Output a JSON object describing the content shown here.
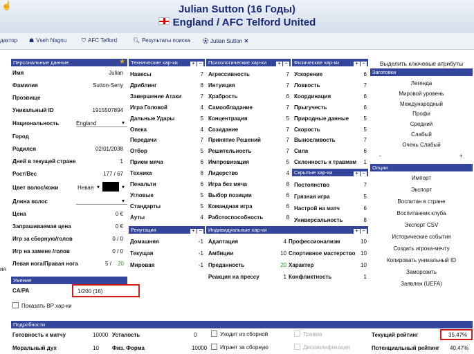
{
  "header": {
    "title": "Julian Sutton (16 Годы)",
    "subtitle": "England / AFC Telford United"
  },
  "tabs": [
    {
      "label": "дактор",
      "icon": ""
    },
    {
      "label": "Vseh Nagnu",
      "icon": "people-icon"
    },
    {
      "label": "AFC Telford",
      "icon": "shield-icon"
    },
    {
      "label": "Результаты поиска",
      "icon": "search-icon"
    },
    {
      "label": "Julian Sutton",
      "icon": "player-icon",
      "close": "✕"
    }
  ],
  "left_edge_label": "ия",
  "personal": {
    "title": "Персональные данные",
    "rows": [
      {
        "label": "Имя",
        "value": "Julian"
      },
      {
        "label": "Фамилия",
        "value": "Sutton-Seriy"
      },
      {
        "label": "Прозвище",
        "value": ""
      },
      {
        "label": "Уникальный ID",
        "value": "1915507894"
      },
      {
        "label": "Национальность",
        "value": "England"
      },
      {
        "label": "Город",
        "value": ""
      },
      {
        "label": "Родился",
        "value": "02/01/2038"
      },
      {
        "label": "Дней в текущей стране",
        "value": "1"
      },
      {
        "label": "Рост/Вес",
        "value": "177 / 67"
      },
      {
        "label": "Цвет волос/кожи",
        "value": "Невая"
      },
      {
        "label": "Длина волос",
        "value": ""
      },
      {
        "label": "Цена",
        "value": "0 €"
      },
      {
        "label": "Запрашиваемая цена",
        "value": "0 €"
      },
      {
        "label": "Игр за сборную/голов",
        "value": "0 / 0"
      },
      {
        "label": "Игр на замене /голов",
        "value": "0 / 0"
      },
      {
        "label": "Левая нога/Правая нога",
        "value": "5 /",
        "value_green": "20"
      }
    ]
  },
  "skill": {
    "title": "Умение",
    "label": "CA/PA",
    "value": "1/200 (16)"
  },
  "show_hidden": "Показать ВР хар-ки",
  "technical": {
    "title": "Технические хар-ки",
    "rows": [
      {
        "label": "Навесы",
        "value": "7"
      },
      {
        "label": "Дриблинг",
        "value": "8"
      },
      {
        "label": "Завершение Атаки",
        "value": "7"
      },
      {
        "label": "Игра Головой",
        "value": "4"
      },
      {
        "label": "Дальные Удары",
        "value": "5"
      },
      {
        "label": "Опека",
        "value": "4"
      },
      {
        "label": "Передачи",
        "value": "7"
      },
      {
        "label": "Отбор",
        "value": "5"
      },
      {
        "label": "Прием мяча",
        "value": "6"
      },
      {
        "label": "Техника",
        "value": "8"
      },
      {
        "label": "Пенальти",
        "value": "6"
      },
      {
        "label": "Угловые",
        "value": "5"
      },
      {
        "label": "Стандарты",
        "value": "5"
      },
      {
        "label": "Ауты",
        "value": "4"
      }
    ]
  },
  "mental": {
    "title": "Психологические хар-ки",
    "rows": [
      {
        "label": "Агрессивность",
        "value": "7"
      },
      {
        "label": "Интуиция",
        "value": "7"
      },
      {
        "label": "Храбрость",
        "value": "6"
      },
      {
        "label": "Самообладание",
        "value": "7"
      },
      {
        "label": "Концентрация",
        "value": "5"
      },
      {
        "label": "Созидание",
        "value": "7"
      },
      {
        "label": "Принятие Решений",
        "value": "7"
      },
      {
        "label": "Решительность",
        "value": "7"
      },
      {
        "label": "Импровизация",
        "value": "5"
      },
      {
        "label": "Лидерство",
        "value": "4"
      },
      {
        "label": "Игра без мяча",
        "value": "8"
      },
      {
        "label": "Выбор позиции",
        "value": "6"
      },
      {
        "label": "Командная игра",
        "value": "6"
      },
      {
        "label": "Работоспособность",
        "value": "8"
      }
    ]
  },
  "physical": {
    "title": "Физические хар-ки",
    "rows": [
      {
        "label": "Ускорение",
        "value": "6"
      },
      {
        "label": "Ловкость",
        "value": "7"
      },
      {
        "label": "Координация",
        "value": "6"
      },
      {
        "label": "Прыгучесть",
        "value": "6"
      },
      {
        "label": "Природные данные",
        "value": "5"
      },
      {
        "label": "Скорость",
        "value": "5"
      },
      {
        "label": "Выносливость",
        "value": "7"
      },
      {
        "label": "Сила",
        "value": "6"
      },
      {
        "label": "Склонность к травмам",
        "value": "1"
      }
    ]
  },
  "hidden": {
    "title": "Скрытые хар-ки",
    "rows": [
      {
        "label": "Постоянство",
        "value": "7"
      },
      {
        "label": "Грязная игра",
        "value": "5"
      },
      {
        "label": "Настрой на матч",
        "value": "6"
      },
      {
        "label": "Универсальность",
        "value": "8"
      }
    ]
  },
  "reputation": {
    "title": "Репутация",
    "rows": [
      {
        "label": "Домашняя",
        "value": "-1"
      },
      {
        "label": "Текущая",
        "value": "-1"
      },
      {
        "label": "Мировая",
        "value": "-1"
      }
    ]
  },
  "individual": {
    "title": "Индивидуальные хар-ки",
    "rows": [
      {
        "label": "Адаптация",
        "value": "4",
        "label2": "Профессионализм",
        "value2": "10"
      },
      {
        "label": "Амбиции",
        "value": "10",
        "label2": "Спортивное мастерство",
        "value2": "10"
      },
      {
        "label": "Преданность",
        "value": "20",
        "label2": "Характер",
        "value2": "10"
      },
      {
        "label": "Реакция на прессу",
        "value": "1",
        "label2": "Конфликтность",
        "value2": "1"
      }
    ]
  },
  "right": {
    "highlight": "Выделить ключевые атрибуты",
    "presets_title": "Заготовки",
    "presets": [
      "Легенда",
      "Мировой уровень",
      "Международный",
      "Профи",
      "Средний",
      "Слабый",
      "Очень Слабый"
    ],
    "presets_minus": "-",
    "presets_plus": "+",
    "options_title": "Опции",
    "options": [
      "Импорт",
      "Экспорт",
      "Воспитан в стране",
      "Воспитанник клуба",
      "Экспорт CSV",
      "Исторические события",
      "Создать игрока-мечту",
      "Копировать уникальный ID",
      "Заморозить",
      "Заявлен (UEFA)"
    ]
  },
  "details": {
    "title": "Подробности",
    "r1": {
      "a": "Готовность к матчу",
      "av": "10000",
      "b": "Усталость",
      "bv": "0",
      "c": "Уходит из сборной",
      "d": "Травма",
      "e": "Текущий рейтинг",
      "ev": "35,47%"
    },
    "r2": {
      "a": "Моральный дух",
      "av": "10",
      "b": "Физ. Форма",
      "bv": "10000",
      "c": "Играет за сборную",
      "d": "Дисквалификация",
      "e": "Потенциальный рейтинг",
      "ev": "40,47%"
    }
  }
}
